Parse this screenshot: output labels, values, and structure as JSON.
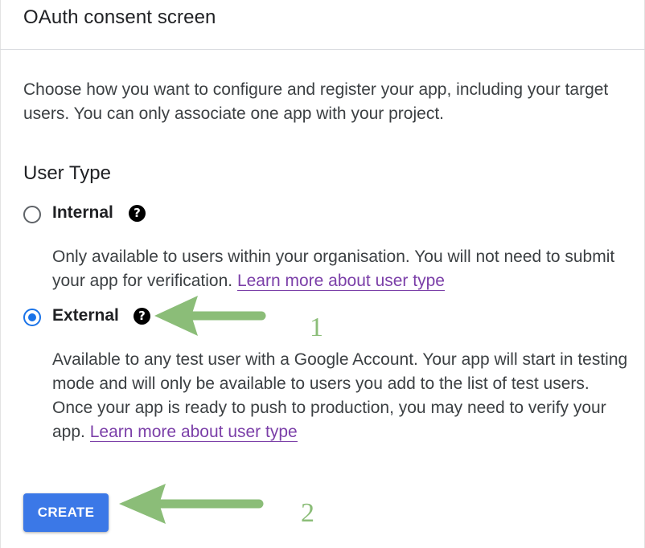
{
  "header": {
    "title": "OAuth consent screen"
  },
  "intro": {
    "text": "Choose how you want to configure and register your app, including your target users. You can only associate one app with your project."
  },
  "user_type": {
    "section_title": "User Type",
    "options": [
      {
        "label": "Internal",
        "selected": false,
        "help_icon": "help-circle-icon",
        "description": "Only available to users within your organisation. You will not need to submit your app for verification.",
        "link_text": "Learn more about user type"
      },
      {
        "label": "External",
        "selected": true,
        "help_icon": "help-circle-icon",
        "description": "Available to any test user with a Google Account. Your app will start in testing mode and will only be available to users you add to the list of test users. Once your app is ready to push to production, you may need to verify your app.",
        "link_text": "Learn more about user type"
      }
    ]
  },
  "actions": {
    "create_label": "CREATE"
  },
  "annotations": {
    "step_1": "1",
    "step_2": "2",
    "arrow_color": "#8bbd78"
  },
  "colors": {
    "accent": "#1a73e8",
    "button": "#3b78e7",
    "link": "#7b3fa8"
  }
}
